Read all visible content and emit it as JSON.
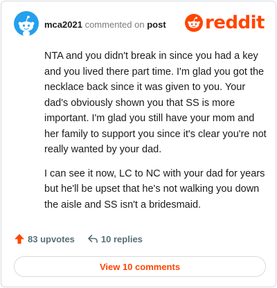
{
  "header": {
    "username": "mca2021",
    "action_text": "commented on",
    "target_text": "post",
    "logo_text": "reddit",
    "avatar_icon": "snoo-avatar-icon",
    "logo_icon": "reddit-snoo-icon"
  },
  "comment": {
    "paragraphs": [
      "NTA and you didn't break in since you had a key and you lived there part time. I'm glad you got the necklace back since it was given to you. Your dad's obviously shown you that SS is more important. I'm glad you still have your mom and her family to support you since it's clear you're not really wanted by your dad.",
      "I can see it now, LC to NC with your dad for years but he'll be upset that he's not walking you down the aisle and SS isn't a bridesmaid."
    ]
  },
  "stats": {
    "upvotes_label": "83 upvotes",
    "replies_label": "10 replies",
    "upvote_icon": "upvote-arrow-icon",
    "reply_icon": "reply-arrow-icon"
  },
  "footer": {
    "view_comments_label": "View 10 comments"
  },
  "colors": {
    "brand": "#ff4500",
    "avatar_bg": "#24a0ed",
    "muted_text": "#576f76",
    "border": "#d7dadc"
  }
}
